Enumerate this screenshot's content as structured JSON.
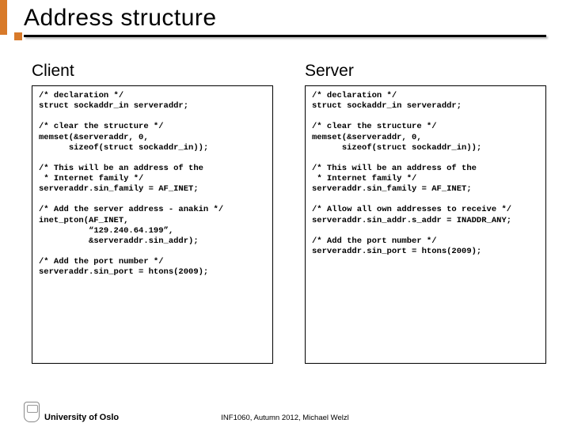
{
  "title": "Address structure",
  "left": {
    "heading": "Client",
    "code": "/* declaration */\nstruct sockaddr_in serveraddr;\n\n/* clear the structure */\nmemset(&serveraddr, 0,\n      sizeof(struct sockaddr_in));\n\n/* This will be an address of the\n * Internet family */\nserveraddr.sin_family = AF_INET;\n\n/* Add the server address - anakin */\ninet_pton(AF_INET,\n          “129.240.64.199”,\n          &serveraddr.sin_addr);\n\n/* Add the port number */\nserveraddr.sin_port = htons(2009);"
  },
  "right": {
    "heading": "Server",
    "code": "/* declaration */\nstruct sockaddr_in serveraddr;\n\n/* clear the structure */\nmemset(&serveraddr, 0,\n      sizeof(struct sockaddr_in));\n\n/* This will be an address of the\n * Internet family */\nserveraddr.sin_family = AF_INET;\n\n/* Allow all own addresses to receive */\nserveraddr.sin_addr.s_addr = INADDR_ANY;\n\n/* Add the port number */\nserveraddr.sin_port = htons(2009);"
  },
  "footer": {
    "university": "University of Oslo",
    "course": "INF1060, Autumn 2012, Michael Welzl"
  }
}
